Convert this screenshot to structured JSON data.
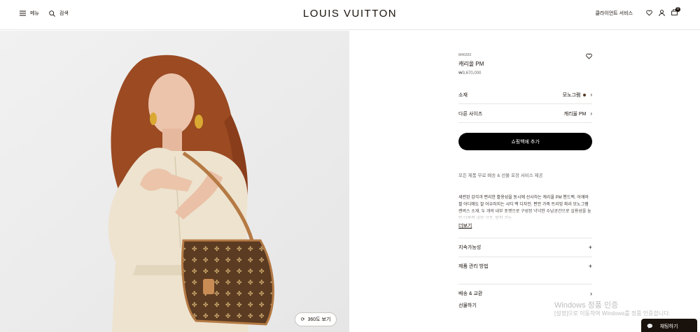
{
  "header": {
    "menu_label": "메뉴",
    "search_label": "검색",
    "logo": "LOUIS VUITTON",
    "client_service": "클라이언트 서비스",
    "cart_count": "0"
  },
  "hero": {
    "view360_label": "360도 보기"
  },
  "product": {
    "sku": "M46203",
    "name": "캐리올 PM",
    "price": "₩3,670,000"
  },
  "options": [
    {
      "label": "소재",
      "value": "모노그램"
    },
    {
      "label": "다른 사이즈",
      "value": "캐리올 PM"
    }
  ],
  "cta_label": "쇼핑백에 추가",
  "shipping_note": "모든 제품 무료 배송 & 선물 포장 서비스 제공",
  "description": "세련된 감각과 편리한 활용성을 동시에 선사하는 캐리올 PM 핸드백. 어깨와 팔 어디에도 잘 어우러지는 시티 백 디자인. 편안 가죽 트리밍 파리 모노그램 캔버스 소재, 두 개의 내부 포켓으로 구성된 넉넉한 수납공간으로 실용성을 높인 다목적 내부 구조. 탈착 가능",
  "more_label": "더보기",
  "accordions": [
    {
      "label": "지속가능성",
      "symbol": "+"
    },
    {
      "label": "제품 관리 방법",
      "symbol": "+"
    },
    {
      "label": "배송 & 교환",
      "symbol": "›"
    },
    {
      "label": "선물하기",
      "symbol": ""
    }
  ],
  "watermark": {
    "line1": "Windows 정품 인증",
    "line2": "[설정]으로 이동하여 Windows를 정품 인증합니다."
  },
  "chat_label": "채팅하기"
}
